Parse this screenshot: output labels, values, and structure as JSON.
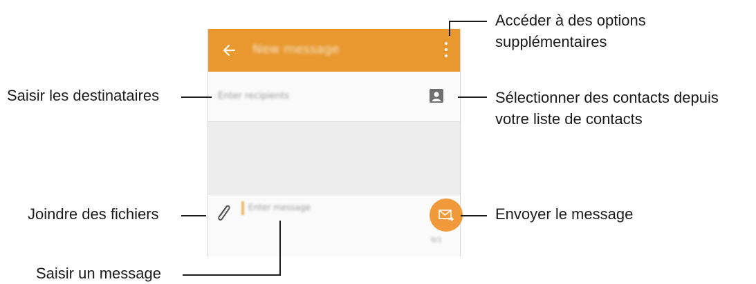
{
  "screen": {
    "appbar": {
      "title": "New message",
      "back_icon": "arrow-left-icon",
      "more_icon": "more-vertical-icon",
      "color": "#e8982e"
    },
    "recipients": {
      "placeholder": "Enter recipients",
      "contacts_icon": "contact-card-icon"
    },
    "composer": {
      "attach_icon": "paperclip-icon",
      "placeholder": "Enter message",
      "send_icon": "envelope-send-icon",
      "send_color": "#f19a3b",
      "counter": "0/1"
    }
  },
  "callouts": {
    "more_options": {
      "line1": "Accéder à des options",
      "line2": "supplémentaires"
    },
    "recipients": "Saisir les destinataires",
    "contacts": {
      "line1": "Sélectionner des contacts depuis",
      "line2": "votre liste de contacts"
    },
    "attach": "Joindre des fichiers",
    "send": "Envoyer le message",
    "message": "Saisir un message"
  }
}
